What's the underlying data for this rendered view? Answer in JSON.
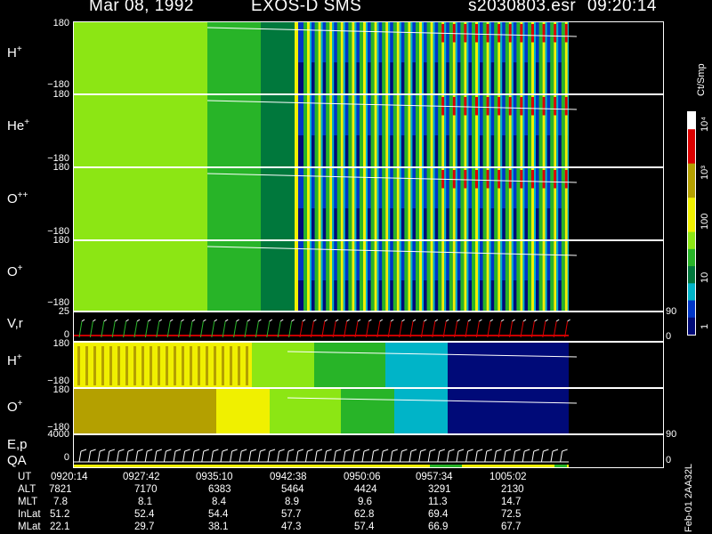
{
  "header": {
    "date": "Mar 08, 1992",
    "instrument": "EXOS-D SMS",
    "file": "s2030803.esr",
    "time": "09:20:14"
  },
  "colorbar": {
    "label": "Ct/Smp",
    "ticks": [
      "1",
      "10",
      "100",
      "10³",
      "10⁴"
    ]
  },
  "panels": [
    {
      "label": "H",
      "sup": "+",
      "top_tick": "180",
      "bottom_tick": "−180"
    },
    {
      "label": "He",
      "sup": "+",
      "top_tick": "180",
      "bottom_tick": "−180"
    },
    {
      "label": "O",
      "sup": "++",
      "top_tick": "180",
      "bottom_tick": "−180"
    },
    {
      "label": "O",
      "sup": "+",
      "top_tick": "180",
      "bottom_tick": "−180"
    },
    {
      "label": "V,r",
      "sup": "",
      "top_tick": "25",
      "bottom_tick": "0",
      "right_top": "90",
      "right_bottom": "0"
    },
    {
      "label": "H",
      "sup": "+",
      "top_tick": "180",
      "bottom_tick": "−180"
    },
    {
      "label": "O",
      "sup": "+",
      "top_tick": "180",
      "bottom_tick": "−180"
    },
    {
      "label": "E,p",
      "sup": "",
      "label2": "QA",
      "top_tick": "4000",
      "bottom_tick": "0",
      "right_top": "90",
      "right_bottom": "0"
    }
  ],
  "orbit_table": {
    "labels": [
      "UT",
      "ALT",
      "MLT",
      "InLat",
      "MLat"
    ],
    "UT": [
      "0920:14",
      "0927:42",
      "0935:10",
      "0942:38",
      "0950:06",
      "0957:34",
      "1005:02"
    ],
    "ALT": [
      "7821",
      "7170",
      "6383",
      "5464",
      "4424",
      "3291",
      "2130"
    ],
    "MLT": [
      "7.8",
      "8.1",
      "8.4",
      "8.9",
      "9.6",
      "11.3",
      "14.7"
    ],
    "InLat": [
      "51.2",
      "52.4",
      "54.4",
      "57.7",
      "62.8",
      "69.4",
      "72.5"
    ],
    "MLat": [
      "22.1",
      "29.7",
      "38.1",
      "47.3",
      "57.4",
      "66.9",
      "67.7"
    ]
  },
  "footer_id": "Feb-01 2AA32L",
  "chart_data": {
    "type": "heatmap",
    "title": "Mar 08, 1992   EXOS-D SMS",
    "xlabel": "UT",
    "x": [
      "0920:14",
      "0927:42",
      "0935:10",
      "0942:38",
      "0950:06",
      "0957:34",
      "1005:02"
    ],
    "ylim_pitch_angle": [
      -180,
      180
    ],
    "color_scale": "log",
    "color_range": [
      1,
      10000
    ],
    "colors": {
      "navy": "#000a78",
      "blue": "#0036c8",
      "cyan": "#00b4c8",
      "green_dark": "#00783c",
      "green": "#28b428",
      "lime": "#8ce614",
      "yellow": "#f0f000",
      "olive": "#b4a000",
      "red": "#dc0000",
      "white": "#ffffff"
    }
  }
}
